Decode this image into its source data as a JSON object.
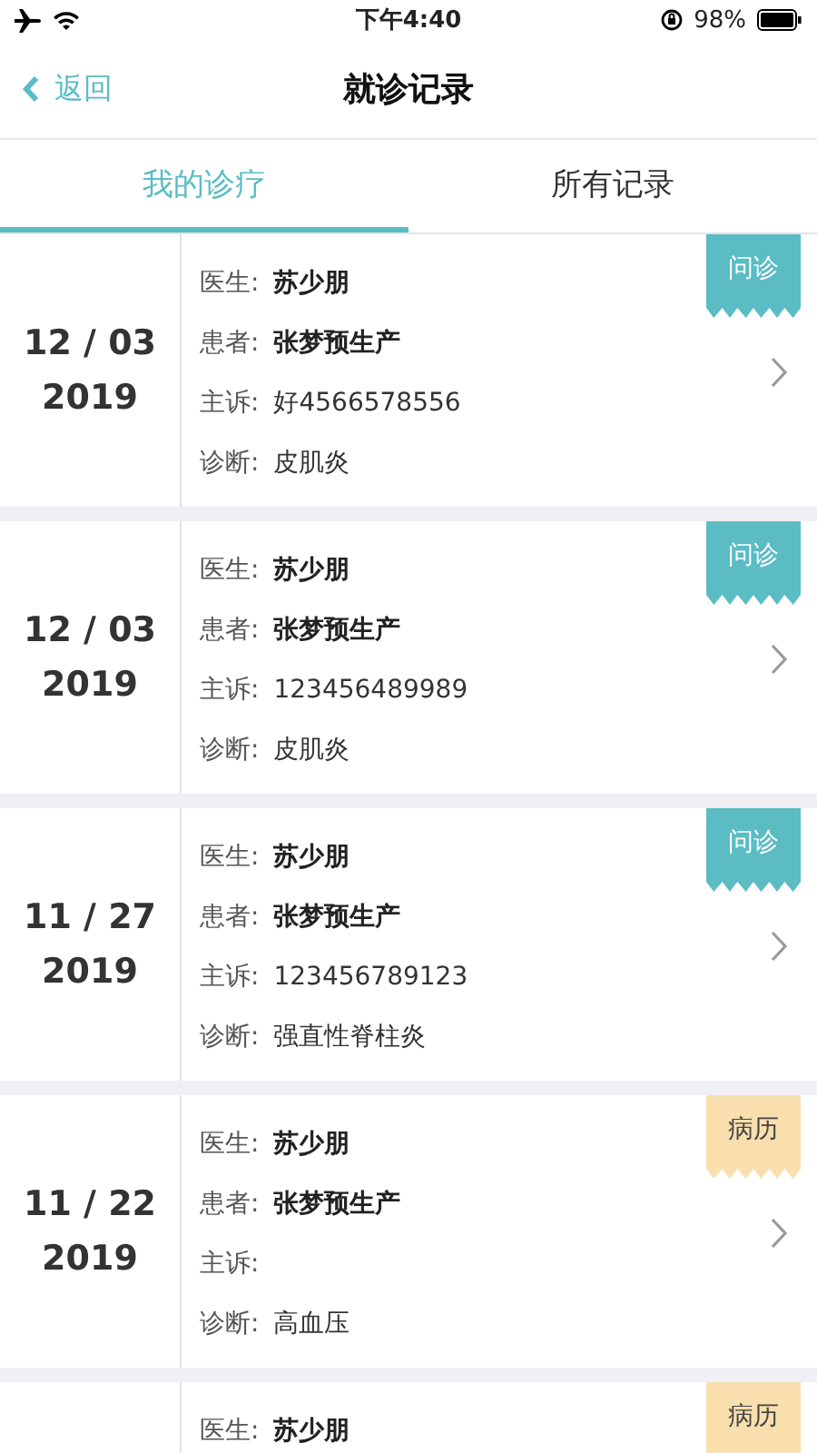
{
  "status_bar": {
    "time": "下午4:40",
    "battery": "98%"
  },
  "nav": {
    "back": "返回",
    "title": "就诊记录"
  },
  "tabs": [
    {
      "label": "我的诊疗",
      "selected": true
    },
    {
      "label": "所有记录",
      "selected": false
    }
  ],
  "records": [
    {
      "date": "12 / 03",
      "year": "2019",
      "badge": {
        "label": "问诊",
        "kind": "consult"
      },
      "fields": [
        {
          "label": "医生:",
          "value": "苏少朋",
          "bold": true
        },
        {
          "label": "患者:",
          "value": "张梦预生产",
          "bold": true
        },
        {
          "label": "主诉:",
          "value": "好4566578556",
          "bold": false
        },
        {
          "label": "诊断:",
          "value": "皮肌炎",
          "bold": false
        }
      ]
    },
    {
      "date": "12 / 03",
      "year": "2019",
      "badge": {
        "label": "问诊",
        "kind": "consult"
      },
      "fields": [
        {
          "label": "医生:",
          "value": "苏少朋",
          "bold": true
        },
        {
          "label": "患者:",
          "value": "张梦预生产",
          "bold": true
        },
        {
          "label": "主诉:",
          "value": "123456489989",
          "bold": false
        },
        {
          "label": "诊断:",
          "value": "皮肌炎",
          "bold": false
        }
      ]
    },
    {
      "date": "11 / 27",
      "year": "2019",
      "badge": {
        "label": "问诊",
        "kind": "consult"
      },
      "fields": [
        {
          "label": "医生:",
          "value": "苏少朋",
          "bold": true
        },
        {
          "label": "患者:",
          "value": "张梦预生产",
          "bold": true
        },
        {
          "label": "主诉:",
          "value": "123456789123",
          "bold": false
        },
        {
          "label": "诊断:",
          "value": "强直性脊柱炎",
          "bold": false
        }
      ]
    },
    {
      "date": "11 / 22",
      "year": "2019",
      "badge": {
        "label": "病历",
        "kind": "record"
      },
      "fields": [
        {
          "label": "医生:",
          "value": "苏少朋",
          "bold": true
        },
        {
          "label": "患者:",
          "value": "张梦预生产",
          "bold": true
        },
        {
          "label": "主诉:"
        },
        {
          "label": "诊断:",
          "value": "高血压",
          "bold": false
        }
      ]
    },
    {
      "badge": {
        "label": "病历",
        "kind": "record"
      },
      "fields": [
        {
          "label": "医生:",
          "value": "苏少朋",
          "bold": true
        }
      ]
    }
  ]
}
